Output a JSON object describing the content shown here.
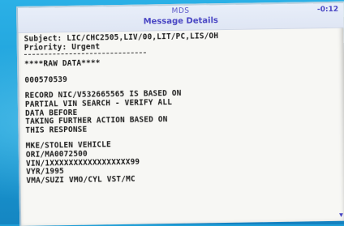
{
  "window": {
    "app_name": "MDS",
    "title": "Message Details",
    "clock": "-0:12"
  },
  "message": {
    "subject": "Subject: LIC/CHC2505,LIV/00,LIT/PC,LIS/OH",
    "priority": "Priority: Urgent",
    "section_header": "****RAW DATA****",
    "record_id": "000570539",
    "notice_lines": [
      "RECORD NIC/V532665565 IS BASED ON",
      "PARTIAL VIN SEARCH - VERIFY ALL",
      "DATA BEFORE",
      "TAKING FURTHER ACTION BASED ON",
      "THIS RESPONSE"
    ],
    "detail_lines": [
      "MKE/STOLEN VEHICLE",
      "ORI/MA0072500",
      "VIN/1XXXXXXXXXXXXXXXXX99",
      "VYR/1995",
      "VMA/SUZI VMO/CYL VST/MC"
    ]
  },
  "icons": {
    "scroll": "scroll-down-arrow-icon"
  }
}
